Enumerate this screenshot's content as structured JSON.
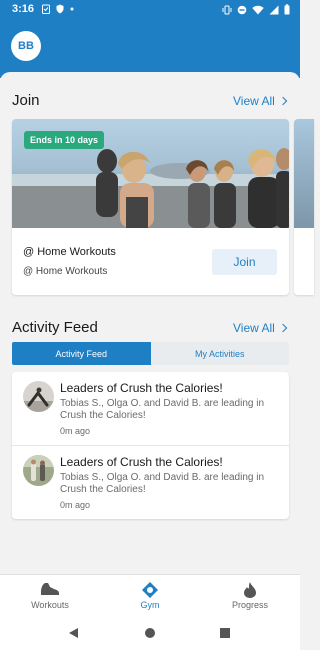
{
  "status_bar": {
    "time": "3:16"
  },
  "header": {
    "avatar_initials": "BB"
  },
  "join_section": {
    "title": "Join",
    "view_all": "View All",
    "card": {
      "badge": "Ends in 10 days",
      "title": "@ Home Workouts",
      "subtitle": "@ Home Workouts",
      "join_label": "Join"
    }
  },
  "activity_section": {
    "title": "Activity Feed",
    "view_all": "View All",
    "tabs": [
      {
        "label": "Activity Feed",
        "active": true
      },
      {
        "label": "My Activities",
        "active": false
      }
    ],
    "items": [
      {
        "title": "Leaders of Crush the Calories!",
        "description": "Tobias S., Olga O. and David B. are leading in Crush the Calories!",
        "time": "0m ago"
      },
      {
        "title": "Leaders of Crush the Calories!",
        "description": "Tobias S., Olga O. and David B. are leading in Crush the Calories!",
        "time": "0m ago"
      }
    ]
  },
  "bottom_nav": [
    {
      "label": "Workouts",
      "icon": "sneaker-icon",
      "active": false
    },
    {
      "label": "Gym",
      "icon": "gym-location-icon",
      "active": true
    },
    {
      "label": "Progress",
      "icon": "flame-icon",
      "active": false
    }
  ],
  "colors": {
    "brand": "#1f7fc4",
    "badge": "#2aa87e",
    "background": "#f2f2f2"
  }
}
